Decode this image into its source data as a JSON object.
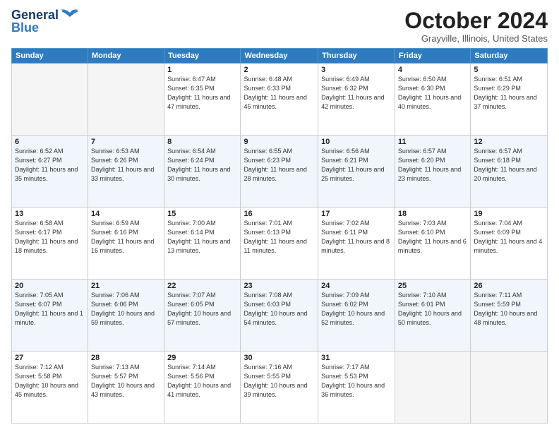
{
  "logo": {
    "line1": "General",
    "line2": "Blue"
  },
  "title": "October 2024",
  "subtitle": "Grayville, Illinois, United States",
  "days_of_week": [
    "Sunday",
    "Monday",
    "Tuesday",
    "Wednesday",
    "Thursday",
    "Friday",
    "Saturday"
  ],
  "weeks": [
    [
      {
        "day": "",
        "info": ""
      },
      {
        "day": "",
        "info": ""
      },
      {
        "day": "1",
        "info": "Sunrise: 6:47 AM\nSunset: 6:35 PM\nDaylight: 11 hours and 47 minutes."
      },
      {
        "day": "2",
        "info": "Sunrise: 6:48 AM\nSunset: 6:33 PM\nDaylight: 11 hours and 45 minutes."
      },
      {
        "day": "3",
        "info": "Sunrise: 6:49 AM\nSunset: 6:32 PM\nDaylight: 11 hours and 42 minutes."
      },
      {
        "day": "4",
        "info": "Sunrise: 6:50 AM\nSunset: 6:30 PM\nDaylight: 11 hours and 40 minutes."
      },
      {
        "day": "5",
        "info": "Sunrise: 6:51 AM\nSunset: 6:29 PM\nDaylight: 11 hours and 37 minutes."
      }
    ],
    [
      {
        "day": "6",
        "info": "Sunrise: 6:52 AM\nSunset: 6:27 PM\nDaylight: 11 hours and 35 minutes."
      },
      {
        "day": "7",
        "info": "Sunrise: 6:53 AM\nSunset: 6:26 PM\nDaylight: 11 hours and 33 minutes."
      },
      {
        "day": "8",
        "info": "Sunrise: 6:54 AM\nSunset: 6:24 PM\nDaylight: 11 hours and 30 minutes."
      },
      {
        "day": "9",
        "info": "Sunrise: 6:55 AM\nSunset: 6:23 PM\nDaylight: 11 hours and 28 minutes."
      },
      {
        "day": "10",
        "info": "Sunrise: 6:56 AM\nSunset: 6:21 PM\nDaylight: 11 hours and 25 minutes."
      },
      {
        "day": "11",
        "info": "Sunrise: 6:57 AM\nSunset: 6:20 PM\nDaylight: 11 hours and 23 minutes."
      },
      {
        "day": "12",
        "info": "Sunrise: 6:57 AM\nSunset: 6:18 PM\nDaylight: 11 hours and 20 minutes."
      }
    ],
    [
      {
        "day": "13",
        "info": "Sunrise: 6:58 AM\nSunset: 6:17 PM\nDaylight: 11 hours and 18 minutes."
      },
      {
        "day": "14",
        "info": "Sunrise: 6:59 AM\nSunset: 6:16 PM\nDaylight: 11 hours and 16 minutes."
      },
      {
        "day": "15",
        "info": "Sunrise: 7:00 AM\nSunset: 6:14 PM\nDaylight: 11 hours and 13 minutes."
      },
      {
        "day": "16",
        "info": "Sunrise: 7:01 AM\nSunset: 6:13 PM\nDaylight: 11 hours and 11 minutes."
      },
      {
        "day": "17",
        "info": "Sunrise: 7:02 AM\nSunset: 6:11 PM\nDaylight: 11 hours and 8 minutes."
      },
      {
        "day": "18",
        "info": "Sunrise: 7:03 AM\nSunset: 6:10 PM\nDaylight: 11 hours and 6 minutes."
      },
      {
        "day": "19",
        "info": "Sunrise: 7:04 AM\nSunset: 6:09 PM\nDaylight: 11 hours and 4 minutes."
      }
    ],
    [
      {
        "day": "20",
        "info": "Sunrise: 7:05 AM\nSunset: 6:07 PM\nDaylight: 11 hours and 1 minute."
      },
      {
        "day": "21",
        "info": "Sunrise: 7:06 AM\nSunset: 6:06 PM\nDaylight: 10 hours and 59 minutes."
      },
      {
        "day": "22",
        "info": "Sunrise: 7:07 AM\nSunset: 6:05 PM\nDaylight: 10 hours and 57 minutes."
      },
      {
        "day": "23",
        "info": "Sunrise: 7:08 AM\nSunset: 6:03 PM\nDaylight: 10 hours and 54 minutes."
      },
      {
        "day": "24",
        "info": "Sunrise: 7:09 AM\nSunset: 6:02 PM\nDaylight: 10 hours and 52 minutes."
      },
      {
        "day": "25",
        "info": "Sunrise: 7:10 AM\nSunset: 6:01 PM\nDaylight: 10 hours and 50 minutes."
      },
      {
        "day": "26",
        "info": "Sunrise: 7:11 AM\nSunset: 5:59 PM\nDaylight: 10 hours and 48 minutes."
      }
    ],
    [
      {
        "day": "27",
        "info": "Sunrise: 7:12 AM\nSunset: 5:58 PM\nDaylight: 10 hours and 45 minutes."
      },
      {
        "day": "28",
        "info": "Sunrise: 7:13 AM\nSunset: 5:57 PM\nDaylight: 10 hours and 43 minutes."
      },
      {
        "day": "29",
        "info": "Sunrise: 7:14 AM\nSunset: 5:56 PM\nDaylight: 10 hours and 41 minutes."
      },
      {
        "day": "30",
        "info": "Sunrise: 7:16 AM\nSunset: 5:55 PM\nDaylight: 10 hours and 39 minutes."
      },
      {
        "day": "31",
        "info": "Sunrise: 7:17 AM\nSunset: 5:53 PM\nDaylight: 10 hours and 36 minutes."
      },
      {
        "day": "",
        "info": ""
      },
      {
        "day": "",
        "info": ""
      }
    ]
  ],
  "colors": {
    "header_bg": "#2e7bbf",
    "row_shade": "#f0f6fc"
  }
}
